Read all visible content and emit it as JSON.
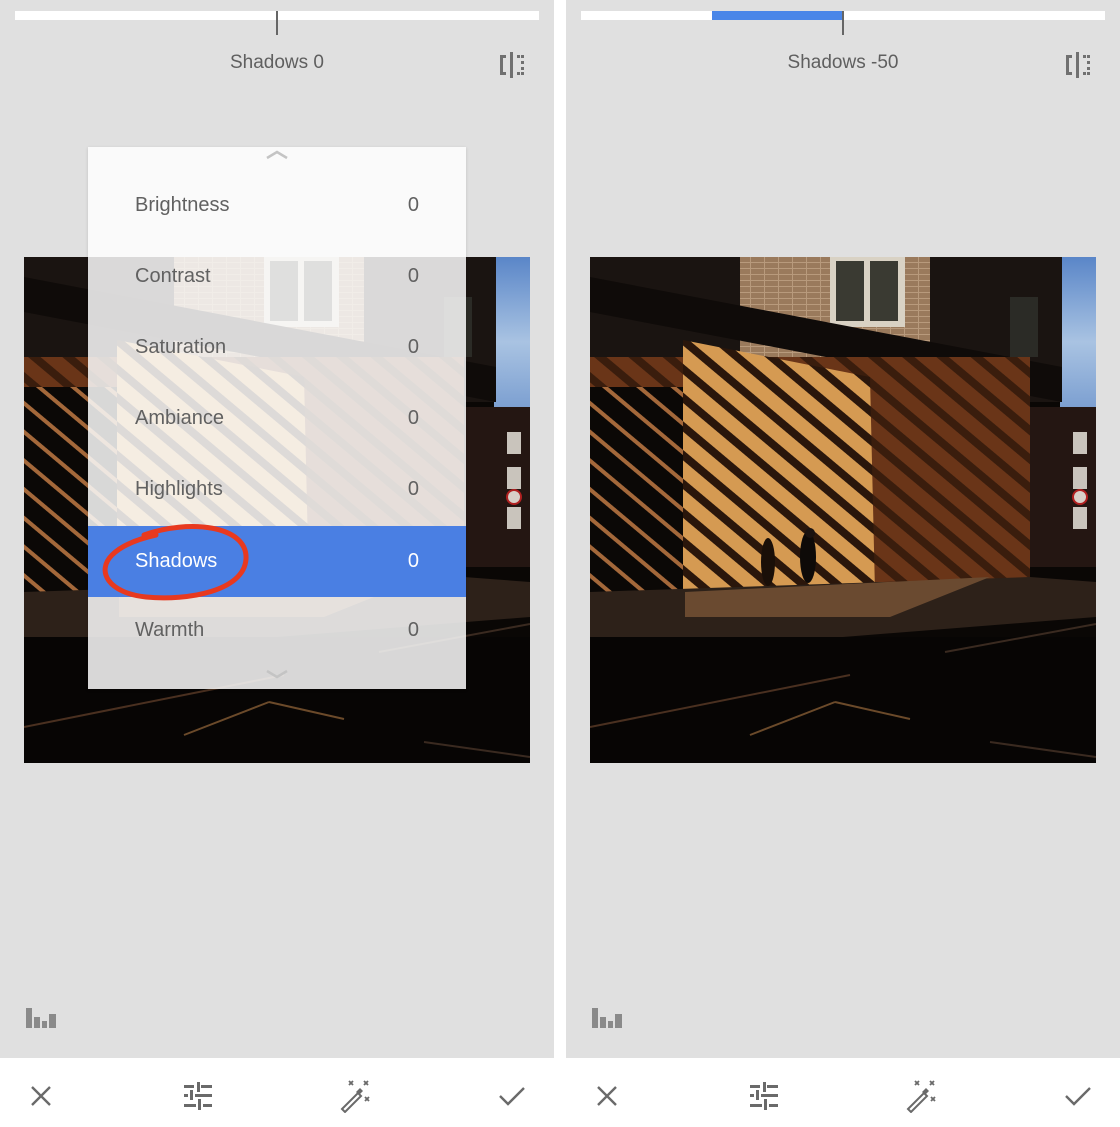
{
  "colors": {
    "accent": "#4a86e8",
    "selected_row": "#4a7fe3",
    "annotation": "#e8391f",
    "canvas_bg": "#e0e0e0",
    "icon": "#707070"
  },
  "panels": [
    {
      "id": "before",
      "header": {
        "label": "Shadows 0",
        "value": 0
      },
      "slider": {
        "min": -100,
        "max": 100,
        "value": 0
      },
      "compare_icon": "compare-split-icon",
      "menu": {
        "visible": true,
        "scroll_up_icon": "chevron-up-icon",
        "scroll_down_icon": "chevron-down-icon",
        "items": [
          {
            "label": "Brightness",
            "value": "0",
            "selected": false
          },
          {
            "label": "Contrast",
            "value": "0",
            "selected": false
          },
          {
            "label": "Saturation",
            "value": "0",
            "selected": false
          },
          {
            "label": "Ambiance",
            "value": "0",
            "selected": false
          },
          {
            "label": "Highlights",
            "value": "0",
            "selected": false
          },
          {
            "label": "Shadows",
            "value": "0",
            "selected": true
          },
          {
            "label": "Warmth",
            "value": "0",
            "selected": false
          }
        ]
      },
      "histogram_icon": "histogram-icon",
      "bottom_bar": [
        {
          "name": "cancel",
          "icon": "close-icon"
        },
        {
          "name": "adjust",
          "icon": "sliders-icon"
        },
        {
          "name": "auto",
          "icon": "magic-wand-icon"
        },
        {
          "name": "apply",
          "icon": "checkmark-icon"
        }
      ]
    },
    {
      "id": "after",
      "header": {
        "label": "Shadows -50",
        "value": -50
      },
      "slider": {
        "min": -100,
        "max": 100,
        "value": -50
      },
      "compare_icon": "compare-split-icon",
      "histogram_icon": "histogram-icon",
      "bottom_bar": [
        {
          "name": "cancel",
          "icon": "close-icon"
        },
        {
          "name": "adjust",
          "icon": "sliders-icon"
        },
        {
          "name": "auto",
          "icon": "magic-wand-icon"
        },
        {
          "name": "apply",
          "icon": "checkmark-icon"
        }
      ]
    }
  ]
}
